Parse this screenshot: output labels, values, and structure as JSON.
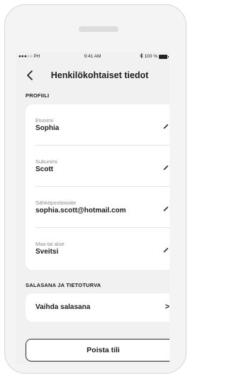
{
  "status_bar": {
    "carrier": "●●●○○ PH",
    "time": "9:41 AM",
    "battery": "100 %",
    "wifi_icon": "wifi-icon",
    "bluetooth_icon": "bluetooth-icon",
    "battery_icon": "battery-icon"
  },
  "nav": {
    "back_icon": "chevron-left-icon",
    "title": "Henkilökohtaiset tiedot"
  },
  "profile": {
    "header": "PROFIILI",
    "fields": [
      {
        "label": "Etunimi",
        "value": "Sophia",
        "icon": "pencil-icon"
      },
      {
        "label": "Sukunimi",
        "value": "Scott",
        "icon": "pencil-icon"
      },
      {
        "label": "Sähköpostiosoite",
        "value": "sophia.scott@hotmail.com",
        "icon": "pencil-icon"
      },
      {
        "label": "Maa tai alue",
        "value": "Sveitsi",
        "icon": "pencil-icon"
      }
    ]
  },
  "security": {
    "header": "SALASANA JA TIETOTURVA",
    "change_password_label": "Vaihda salasana",
    "chevron": ">"
  },
  "actions": {
    "delete_account_label": "Poista tili"
  }
}
